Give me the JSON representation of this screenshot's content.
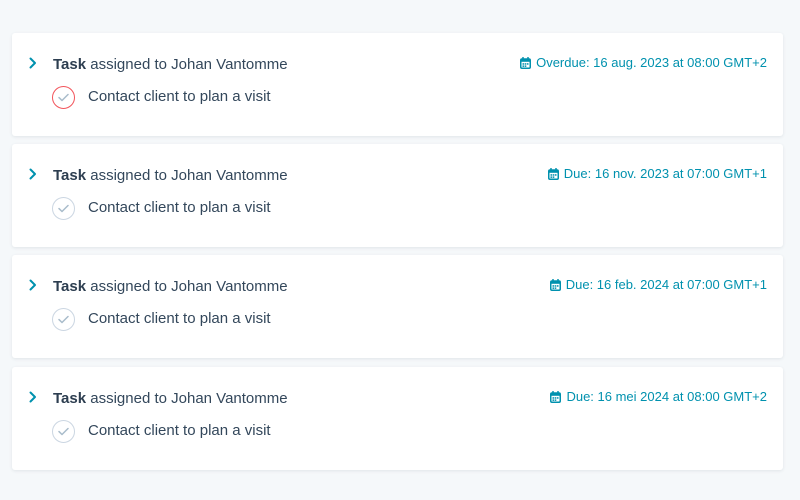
{
  "colors": {
    "background": "#f5f8fa",
    "card": "#ffffff",
    "text": "#33475b",
    "accent": "#0091ae",
    "overdue_ring": "#f2545b",
    "check_ring": "#cbd6e2"
  },
  "tasks": [
    {
      "type_label": "Task",
      "assignment": "assigned to Johan Vantomme",
      "due_text": "Overdue: 16 aug. 2023 at 08:00 GMT+2",
      "title": "Contact client to plan a visit",
      "overdue": true,
      "icons": {
        "expand": "chevron-right-icon",
        "due": "calendar-icon",
        "complete": "checkmark-circle-icon"
      }
    },
    {
      "type_label": "Task",
      "assignment": "assigned to Johan Vantomme",
      "due_text": "Due: 16 nov. 2023 at 07:00 GMT+1",
      "title": "Contact client to plan a visit",
      "overdue": false,
      "icons": {
        "expand": "chevron-right-icon",
        "due": "calendar-icon",
        "complete": "checkmark-circle-icon"
      }
    },
    {
      "type_label": "Task",
      "assignment": "assigned to Johan Vantomme",
      "due_text": "Due: 16 feb. 2024 at 07:00 GMT+1",
      "title": "Contact client to plan a visit",
      "overdue": false,
      "icons": {
        "expand": "chevron-right-icon",
        "due": "calendar-icon",
        "complete": "checkmark-circle-icon"
      }
    },
    {
      "type_label": "Task",
      "assignment": "assigned to Johan Vantomme",
      "due_text": "Due: 16 mei 2024 at 08:00 GMT+2",
      "title": "Contact client to plan a visit",
      "overdue": false,
      "icons": {
        "expand": "chevron-right-icon",
        "due": "calendar-icon",
        "complete": "checkmark-circle-icon"
      }
    }
  ]
}
